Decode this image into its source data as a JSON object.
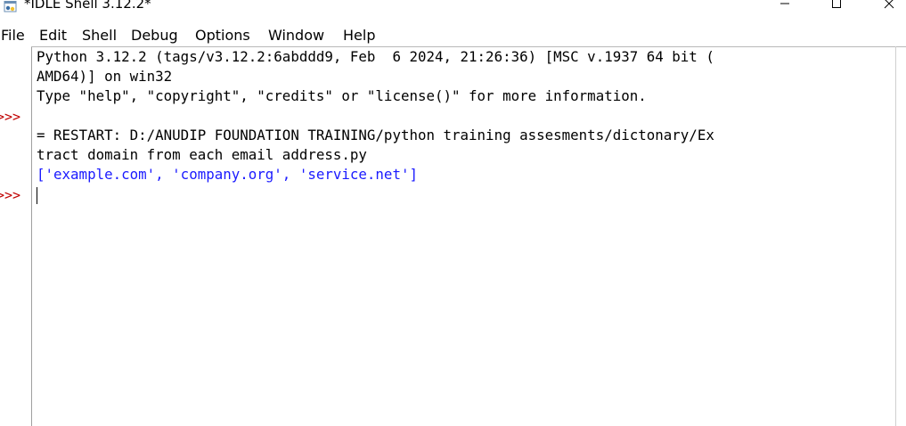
{
  "window": {
    "title": "*IDLE Shell 3.12.2*"
  },
  "menu": {
    "items": [
      {
        "label": "File"
      },
      {
        "label": "Edit"
      },
      {
        "label": "Shell"
      },
      {
        "label": "Debug"
      },
      {
        "label": "Options"
      },
      {
        "label": "Window"
      },
      {
        "label": "Help"
      }
    ]
  },
  "shell": {
    "prompts": [
      ">>>",
      ">>>"
    ],
    "lines": [
      {
        "text": "Python 3.12.2 (tags/v3.12.2:6abddd9, Feb  6 2024, 21:26:36) [MSC v.1937 64 bit (",
        "kind": "normal"
      },
      {
        "text": "AMD64)] on win32",
        "kind": "normal"
      },
      {
        "text": "Type \"help\", \"copyright\", \"credits\" or \"license()\" for more information.",
        "kind": "normal"
      },
      {
        "text": "",
        "kind": "normal"
      },
      {
        "text": "= RESTART: D:/ANUDIP FOUNDATION TRAINING/python training assesments/dictonary/Ex",
        "kind": "normal"
      },
      {
        "text": "tract domain from each email address.py",
        "kind": "normal"
      },
      {
        "text": "['example.com', 'company.org', 'service.net']",
        "kind": "output"
      }
    ]
  },
  "icons": {
    "app": "python-idle-icon",
    "minimize": "minimize-icon",
    "maximize": "maximize-icon",
    "close": "close-icon"
  },
  "colors": {
    "prompt": "#c00000",
    "output": "#1a1aff",
    "text": "#000000"
  }
}
